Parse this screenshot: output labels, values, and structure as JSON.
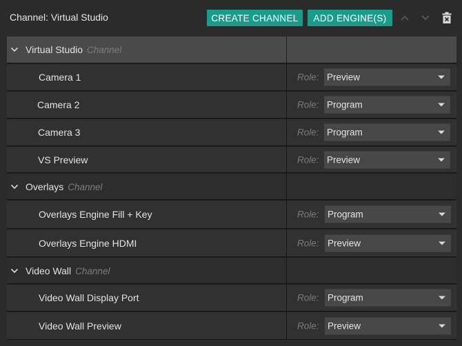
{
  "header": {
    "title": "Channel: Virtual Studio",
    "create_channel_label": "CREATE CHANNEL",
    "add_engines_label": "ADD ENGINE(S)"
  },
  "role_label": "Role:",
  "channels": [
    {
      "name": "Virtual Studio",
      "type": "Channel",
      "engines": [
        {
          "name": "Camera 1",
          "role": "Preview"
        },
        {
          "name": "Camera 2",
          "role": "Program"
        },
        {
          "name": "Camera 3",
          "role": "Program"
        },
        {
          "name": "VS Preview",
          "role": "Preview"
        }
      ]
    },
    {
      "name": "Overlays",
      "type": "Channel",
      "engines": [
        {
          "name": "Overlays Engine Fill + Key",
          "role": "Program"
        },
        {
          "name": "Overlays Engine HDMI",
          "role": "Preview"
        }
      ]
    },
    {
      "name": "Video Wall",
      "type": "Channel",
      "engines": [
        {
          "name": "Video Wall Display Port",
          "role": "Program"
        },
        {
          "name": "Video Wall Preview",
          "role": "Preview"
        }
      ]
    }
  ],
  "colors": {
    "accent": "#1a9c8c",
    "background": "#2b2b2b",
    "selected_row": "#4a4a4a"
  },
  "icons": {
    "chevron_up": "chevron-up-icon",
    "chevron_down": "chevron-down-icon",
    "delete": "trash-icon",
    "expand": "chevron-down-icon",
    "dropdown": "caret-down-icon"
  }
}
